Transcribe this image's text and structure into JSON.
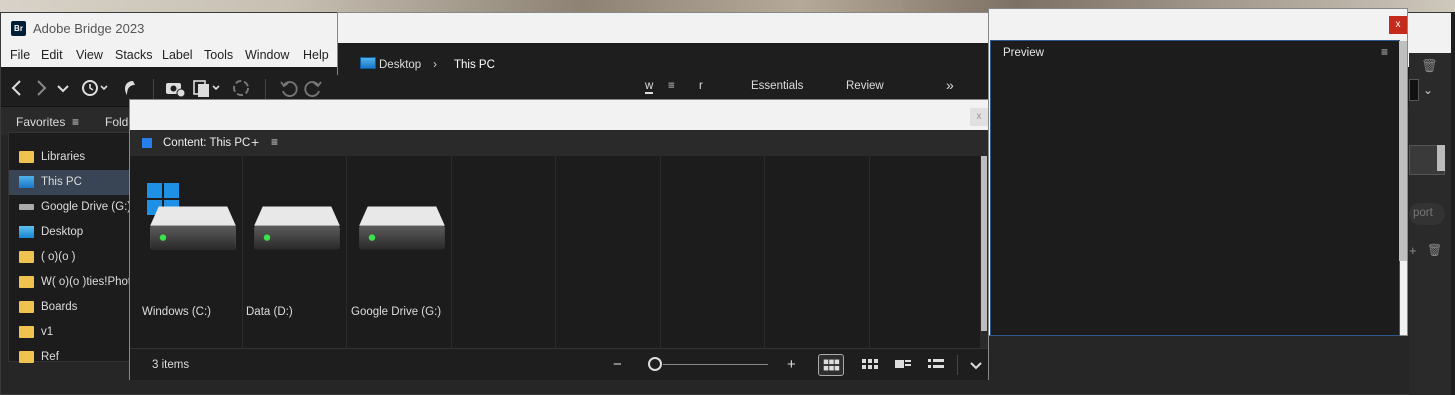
{
  "app": {
    "logo": "Br",
    "title": "Adobe Bridge 2023"
  },
  "menu": [
    "File",
    "Edit",
    "View",
    "Stacks",
    "Label",
    "Tools",
    "Window",
    "Help"
  ],
  "toolbar": {
    "icons": [
      "back-icon",
      "forward-icon",
      "chevron-down-icon",
      "recent-icon",
      "boomerang-icon",
      "camera-import-icon",
      "copy-icon",
      "refine-icon",
      "rotate-left-icon",
      "rotate-right-icon"
    ]
  },
  "panels": {
    "favorites": "Favorites",
    "folders": "Folde"
  },
  "favorites": [
    {
      "label": "Libraries",
      "icon": "folder-icon"
    },
    {
      "label": "This PC",
      "icon": "monitor-icon",
      "selected": true
    },
    {
      "label": "Google Drive (G:)",
      "icon": "drive-icon"
    },
    {
      "label": "Desktop",
      "icon": "desktop-icon"
    },
    {
      "label": "( o)(o )",
      "icon": "folder-icon"
    },
    {
      "label": "W( o)(o )ties!Phot",
      "icon": "folder-icon"
    },
    {
      "label": "Boards",
      "icon": "folder-icon"
    },
    {
      "label": "v1",
      "icon": "folder-icon"
    },
    {
      "label": "Ref",
      "icon": "folder-icon"
    }
  ],
  "breadcrumb": {
    "desktop": "Desktop",
    "separator": "›",
    "current": "This PC"
  },
  "workspaces": {
    "w": "w",
    "menu": "≡",
    "r": "r",
    "essentials": "Essentials",
    "review": "Review",
    "more": "»"
  },
  "preview": {
    "title": "Preview",
    "menu": "≡",
    "close": "x"
  },
  "content": {
    "title": "Content: This PC",
    "add": "+",
    "menu": "≡",
    "close": "x",
    "drives": [
      {
        "label": "Windows (C:)",
        "icon": "windows-drive-icon"
      },
      {
        "label": "Data (D:)",
        "icon": "hard-drive-icon"
      },
      {
        "label": "Google Drive (G:)",
        "icon": "hard-drive-icon"
      }
    ],
    "status": "3 items",
    "zoom": {
      "minus": "−",
      "plus": "+",
      "level": 0
    }
  },
  "right_edge": {
    "export": "port"
  }
}
